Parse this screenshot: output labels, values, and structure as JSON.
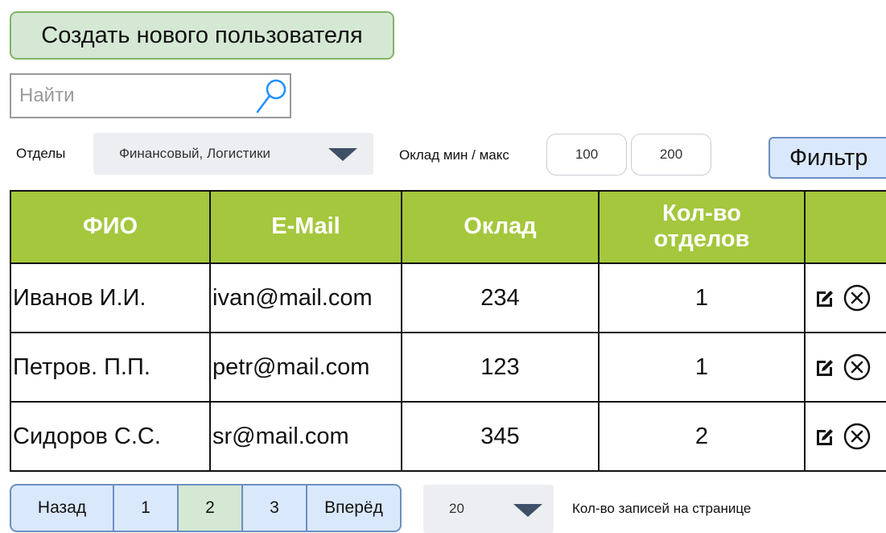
{
  "create_button": {
    "label": "Создать нового пользователя"
  },
  "search": {
    "placeholder": "Найти",
    "value": ""
  },
  "filters": {
    "departments_label": "Отделы",
    "departments_value": "Финансовый, Логистики",
    "salary_label": "Оклад мин / макс",
    "salary_min": "100",
    "salary_max": "200",
    "filter_button": "Фильтр"
  },
  "table": {
    "headers": [
      "ФИО",
      "E-Mail",
      "Оклад",
      "Кол-во\nотделов",
      ""
    ],
    "header_line1": "Кол-во",
    "header_line2": "отделов",
    "rows": [
      {
        "name": "Иванов И.И.",
        "email": "ivan@mail.com",
        "salary": "234",
        "departments": "1"
      },
      {
        "name": "Петров. П.П.",
        "email": "petr@mail.com",
        "salary": "123",
        "departments": "1"
      },
      {
        "name": "Сидоров С.С.",
        "email": "sr@mail.com",
        "salary": "345",
        "departments": "2"
      }
    ]
  },
  "pagination": {
    "prev": "Назад",
    "pages": [
      "1",
      "2",
      "3"
    ],
    "current_page": "2",
    "next": "Вперёд"
  },
  "per_page": {
    "value": "20",
    "label": "Кол-во записей на странице"
  },
  "colors": {
    "accent_green": "#a4c73d",
    "button_green": "#d5e8d4",
    "button_blue": "#dae8fc"
  },
  "icons": {
    "search": "search-icon",
    "dropdown": "triangle-down-icon",
    "edit": "edit-icon",
    "delete": "delete-circle-x-icon"
  }
}
